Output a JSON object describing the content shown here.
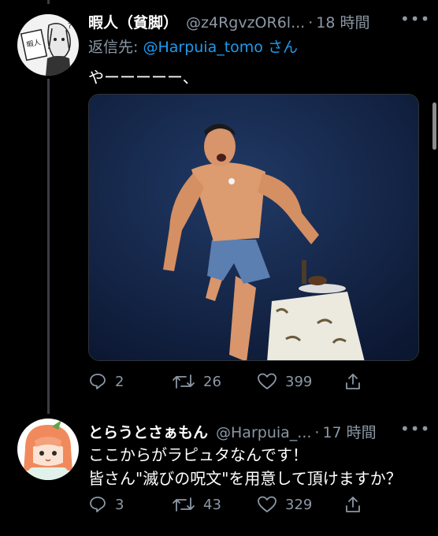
{
  "tweets": [
    {
      "display_name": "暇人（貧脚）",
      "handle": "@z4RgvzOR6l...",
      "separator": "·",
      "time": "18 時間",
      "reply_prefix": "返信先:",
      "reply_mention": "@Harpuia_tomo",
      "reply_suffix": "さん",
      "text": "やーーーーー、",
      "avatar_label": "暇人",
      "actions": {
        "replies": "2",
        "retweets": "26",
        "likes": "399"
      }
    },
    {
      "display_name": "とらうとさぁもん",
      "handle": "@Harpuia_...",
      "separator": "·",
      "time": "17 時間",
      "text_lines": [
        "ここからがラピュタなんです！",
        "皆さん\"滅びの呪文\"を用意して頂けますか？"
      ],
      "actions": {
        "replies": "3",
        "retweets": "43",
        "likes": "329"
      }
    }
  ],
  "colors": {
    "background": "#000000",
    "secondary": "#8b98a5",
    "link": "#1d9bf0",
    "thread_line": "#3a3d41"
  }
}
